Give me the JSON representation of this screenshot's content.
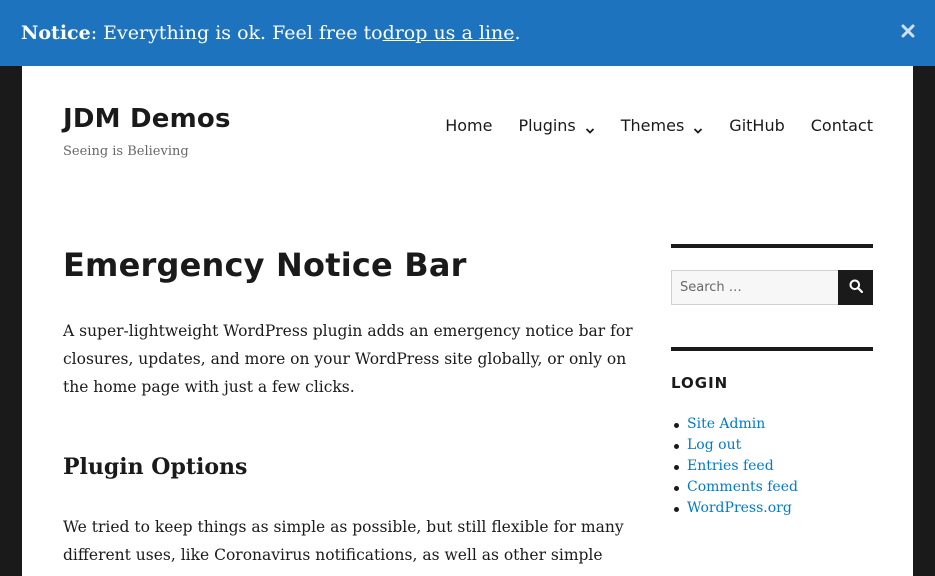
{
  "notice": {
    "label": "Notice",
    "text": ": Everything is ok. Feel free to ",
    "link": "drop us a line",
    "end": ".",
    "close_icon": "close-icon"
  },
  "site": {
    "title": "JDM Demos",
    "tagline": "Seeing is Believing"
  },
  "nav": {
    "items": [
      {
        "label": "Home"
      },
      {
        "label": "Plugins"
      },
      {
        "label": "Themes"
      },
      {
        "label": "GitHub"
      },
      {
        "label": "Contact"
      }
    ]
  },
  "content": {
    "title": "Emergency Notice Bar",
    "p1": "A super-lightweight WordPress plugin adds an emergency notice bar for closures, updates, and more on your WordPress site globally, or only on the home page with just a few clicks.",
    "h2": "Plugin Options",
    "p2": "We tried to keep things as simple as possible, but still flexible for many different uses, like Coronavirus notifications, as well as other simple notifications on your site. Options for displaying the plugin include"
  },
  "sidebar": {
    "search": {
      "placeholder": "Search …"
    },
    "login_title": "LOGIN",
    "login_links": [
      "Site Admin",
      "Log out",
      "Entries feed",
      "Comments feed",
      "WordPress.org"
    ]
  },
  "colors": {
    "notice_bg": "#1e73be",
    "link": "#007acc",
    "text": "#1a1a1a"
  }
}
